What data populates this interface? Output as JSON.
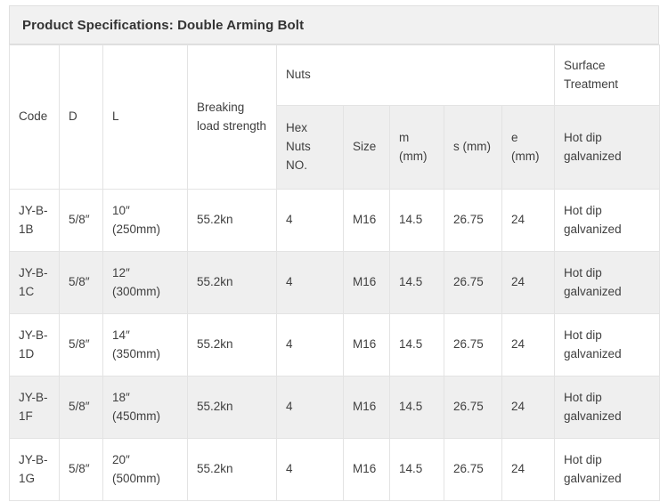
{
  "title": "Product Specifications: Double Arming Bolt",
  "table": {
    "header_groups": {
      "code": "Code",
      "d": "D",
      "l": "L",
      "breaking_load_strength": "Breaking load strength",
      "nuts": "Nuts",
      "surface_treatment": "Surface Treatment"
    },
    "subheaders": {
      "hex_nuts_no": "Hex Nuts NO.",
      "size": "Size",
      "m_mm": "m (mm)",
      "s_mm": "s (mm)",
      "e_mm": "e (mm)",
      "surface_value": "Hot dip galvanized"
    },
    "rows": [
      {
        "code": "JY-B-1B",
        "d": "5/8″",
        "l": "10″ (250mm)",
        "breaking_load_strength": "55.2kn",
        "hex_nuts_no": "4",
        "size": "M16",
        "m_mm": "14.5",
        "s_mm": "26.75",
        "e_mm": "24",
        "surface_treatment": "Hot dip galvanized"
      },
      {
        "code": "JY-B-1C",
        "d": "5/8″",
        "l": "12″ (300mm)",
        "breaking_load_strength": "55.2kn",
        "hex_nuts_no": "4",
        "size": "M16",
        "m_mm": "14.5",
        "s_mm": "26.75",
        "e_mm": "24",
        "surface_treatment": "Hot dip galvanized"
      },
      {
        "code": "JY-B-1D",
        "d": "5/8″",
        "l": "14″ (350mm)",
        "breaking_load_strength": "55.2kn",
        "hex_nuts_no": "4",
        "size": "M16",
        "m_mm": "14.5",
        "s_mm": "26.75",
        "e_mm": "24",
        "surface_treatment": "Hot dip galvanized"
      },
      {
        "code": "JY-B-1F",
        "d": "5/8″",
        "l": "18″ (450mm)",
        "breaking_load_strength": "55.2kn",
        "hex_nuts_no": "4",
        "size": "M16",
        "m_mm": "14.5",
        "s_mm": "26.75",
        "e_mm": "24",
        "surface_treatment": "Hot dip galvanized"
      },
      {
        "code": "JY-B-1G",
        "d": "5/8″",
        "l": "20″ (500mm)",
        "breaking_load_strength": "55.2kn",
        "hex_nuts_no": "4",
        "size": "M16",
        "m_mm": "14.5",
        "s_mm": "26.75",
        "e_mm": "24",
        "surface_treatment": "Hot dip galvanized"
      }
    ]
  },
  "colors": {
    "header_stripe": "#efefef",
    "title_bg": "#f1f1f1",
    "border": "#e3e3e3",
    "text": "#3f3f3f"
  }
}
